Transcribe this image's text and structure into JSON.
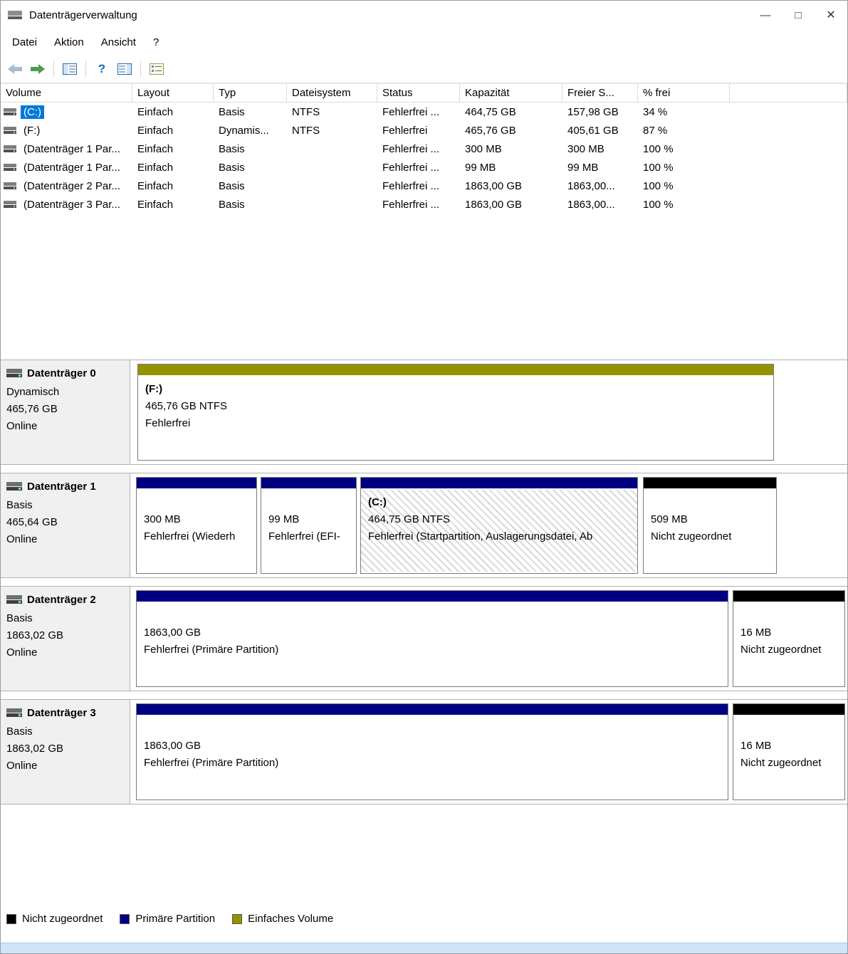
{
  "window": {
    "title": "Datenträgerverwaltung"
  },
  "icons": {
    "minimize": "—",
    "maximize": "□",
    "close": "✕",
    "help": "?"
  },
  "menu": {
    "items": [
      "Datei",
      "Aktion",
      "Ansicht",
      "?"
    ]
  },
  "table": {
    "columns": [
      "Volume",
      "Layout",
      "Typ",
      "Dateisystem",
      "Status",
      "Kapazität",
      "Freier S...",
      "% frei"
    ],
    "rows": [
      {
        "volume": "(C:)",
        "layout": "Einfach",
        "typ": "Basis",
        "fs": "NTFS",
        "status": "Fehlerfrei ...",
        "cap": "464,75 GB",
        "free": "157,98 GB",
        "pct": "34 %"
      },
      {
        "volume": "(F:)",
        "layout": "Einfach",
        "typ": "Dynamis...",
        "fs": "NTFS",
        "status": "Fehlerfrei",
        "cap": "465,76 GB",
        "free": "405,61 GB",
        "pct": "87 %"
      },
      {
        "volume": "(Datenträger 1 Par...",
        "layout": "Einfach",
        "typ": "Basis",
        "fs": "",
        "status": "Fehlerfrei ...",
        "cap": "300 MB",
        "free": "300 MB",
        "pct": "100 %"
      },
      {
        "volume": "(Datenträger 1 Par...",
        "layout": "Einfach",
        "typ": "Basis",
        "fs": "",
        "status": "Fehlerfrei ...",
        "cap": "99 MB",
        "free": "99 MB",
        "pct": "100 %"
      },
      {
        "volume": "(Datenträger 2 Par...",
        "layout": "Einfach",
        "typ": "Basis",
        "fs": "",
        "status": "Fehlerfrei ...",
        "cap": "1863,00 GB",
        "free": "1863,00...",
        "pct": "100 %"
      },
      {
        "volume": "(Datenträger 3 Par...",
        "layout": "Einfach",
        "typ": "Basis",
        "fs": "",
        "status": "Fehlerfrei ...",
        "cap": "1863,00 GB",
        "free": "1863,00...",
        "pct": "100 %"
      }
    ]
  },
  "disks": [
    {
      "name": "Datenträger 0",
      "kind": "Dynamisch",
      "size": "465,76 GB",
      "status": "Online",
      "partitions": [
        {
          "label": "(F:)",
          "size": "465,76 GB NTFS",
          "status": "Fehlerfrei",
          "type": "simple"
        }
      ]
    },
    {
      "name": "Datenträger 1",
      "kind": "Basis",
      "size": "465,64 GB",
      "status": "Online",
      "partitions": [
        {
          "label": "",
          "size": "300 MB",
          "status": "Fehlerfrei (Wiederh",
          "type": "primary"
        },
        {
          "label": "",
          "size": "99 MB",
          "status": "Fehlerfrei (EFI-",
          "type": "primary"
        },
        {
          "label": "(C:)",
          "size": "464,75 GB NTFS",
          "status": "Fehlerfrei (Startpartition, Auslagerungsdatei, Ab",
          "type": "primary"
        },
        {
          "label": "",
          "size": "509 MB",
          "status": "Nicht zugeordnet",
          "type": "unallocated"
        }
      ]
    },
    {
      "name": "Datenträger 2",
      "kind": "Basis",
      "size": "1863,02 GB",
      "status": "Online",
      "partitions": [
        {
          "label": "",
          "size": "1863,00 GB",
          "status": "Fehlerfrei (Primäre Partition)",
          "type": "primary"
        },
        {
          "label": "",
          "size": "16 MB",
          "status": "Nicht zugeordnet",
          "type": "unallocated"
        }
      ]
    },
    {
      "name": "Datenträger 3",
      "kind": "Basis",
      "size": "1863,02 GB",
      "status": "Online",
      "partitions": [
        {
          "label": "",
          "size": "1863,00 GB",
          "status": "Fehlerfrei (Primäre Partition)",
          "type": "primary"
        },
        {
          "label": "",
          "size": "16 MB",
          "status": "Nicht zugeordnet",
          "type": "unallocated"
        }
      ]
    }
  ],
  "legend": {
    "items": [
      {
        "label": "Nicht zugeordnet",
        "color": "#000000"
      },
      {
        "label": "Primäre Partition",
        "color": "#000082"
      },
      {
        "label": "Einfaches Volume",
        "color": "#939300"
      }
    ]
  }
}
